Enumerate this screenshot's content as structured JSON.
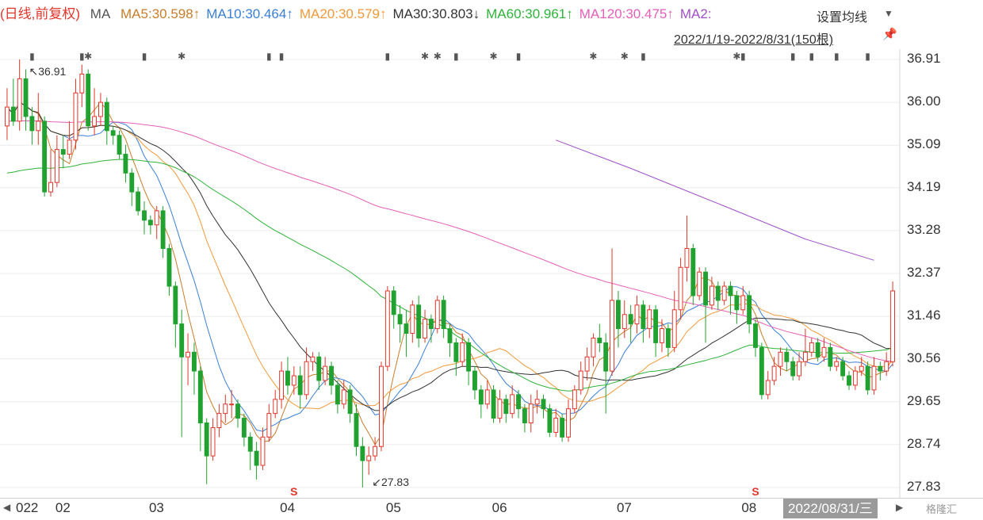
{
  "header": {
    "mode": "(日线,前复权)",
    "ma_label": "MA",
    "ma_items": [
      {
        "text": "MA5:30.598↑",
        "color": "#c87d2c"
      },
      {
        "text": "MA10:30.464↑",
        "color": "#3a7fd6"
      },
      {
        "text": "MA20:30.579↑",
        "color": "#f09a3c"
      },
      {
        "text": "MA30:30.803↓",
        "color": "#333333"
      },
      {
        "text": "MA60:30.961↑",
        "color": "#2fb33a"
      },
      {
        "text": "MA120:30.475↑",
        "color": "#e45fb8"
      },
      {
        "text": "MA2:",
        "color": "#a050c8"
      }
    ],
    "settings_label": "设置均线",
    "settings_arrow": "▼",
    "range": "2022/1/19-2022/8/31(150根)",
    "pin_icon": "pin"
  },
  "chart_data": {
    "type": "candlestick",
    "y_ticks": [
      36.91,
      36.0,
      35.09,
      34.19,
      33.28,
      32.37,
      31.46,
      30.56,
      29.65,
      28.74,
      27.83
    ],
    "ylim": [
      27.83,
      36.91
    ],
    "x_month_labels": [
      {
        "label": "022",
        "index": 0
      },
      {
        "label": "02",
        "index": 8
      },
      {
        "label": "03",
        "index": 23
      },
      {
        "label": "04",
        "index": 44
      },
      {
        "label": "05",
        "index": 61
      },
      {
        "label": "06",
        "index": 78
      },
      {
        "label": "07",
        "index": 98
      },
      {
        "label": "08",
        "index": 118
      }
    ],
    "annotations": [
      {
        "text": "↖36.91",
        "index": 3,
        "value": 36.91
      },
      {
        "text": "↙27.83",
        "index": 58,
        "value": 27.83
      }
    ],
    "event_markers": [
      {
        "text": "S",
        "index": 46
      },
      {
        "text": "S",
        "index": 120
      }
    ],
    "info_marks": [
      {
        "index": 4,
        "type": "bar"
      },
      {
        "index": 12,
        "type": "bar"
      },
      {
        "index": 13,
        "type": "star"
      },
      {
        "index": 22,
        "type": "bar"
      },
      {
        "index": 28,
        "type": "star"
      },
      {
        "index": 42,
        "type": "bar"
      },
      {
        "index": 44,
        "type": "bar"
      },
      {
        "index": 61,
        "type": "bar"
      },
      {
        "index": 67,
        "type": "star"
      },
      {
        "index": 69,
        "type": "star"
      },
      {
        "index": 72,
        "type": "bar"
      },
      {
        "index": 78,
        "type": "star"
      },
      {
        "index": 82,
        "type": "bar"
      },
      {
        "index": 94,
        "type": "star"
      },
      {
        "index": 99,
        "type": "star"
      },
      {
        "index": 102,
        "type": "bar"
      },
      {
        "index": 117,
        "type": "star"
      },
      {
        "index": 118,
        "type": "bar"
      },
      {
        "index": 126,
        "type": "bar"
      },
      {
        "index": 129,
        "type": "bar"
      },
      {
        "index": 133,
        "type": "bar"
      },
      {
        "index": 138,
        "type": "bar"
      }
    ],
    "candles": [
      [
        35.5,
        35.9,
        35.2,
        36.3
      ],
      [
        35.9,
        35.6,
        35.5,
        36.5
      ],
      [
        35.6,
        36.5,
        35.4,
        36.91
      ],
      [
        36.5,
        35.7,
        35.4,
        36.7
      ],
      [
        35.7,
        35.4,
        35.1,
        35.9
      ],
      [
        35.4,
        35.6,
        35.1,
        36.2
      ],
      [
        35.6,
        34.1,
        34.0,
        35.7
      ],
      [
        34.1,
        34.3,
        34.0,
        35.0
      ],
      [
        34.3,
        35.0,
        34.2,
        35.3
      ],
      [
        35.0,
        34.9,
        34.6,
        35.3
      ],
      [
        34.9,
        35.2,
        34.8,
        35.6
      ],
      [
        35.2,
        36.2,
        35.0,
        36.5
      ],
      [
        36.2,
        36.6,
        35.9,
        36.8
      ],
      [
        36.6,
        35.5,
        35.4,
        36.7
      ],
      [
        35.5,
        35.7,
        35.3,
        36.3
      ],
      [
        35.7,
        36.0,
        35.5,
        36.2
      ],
      [
        36.0,
        35.4,
        35.1,
        36.1
      ],
      [
        35.4,
        35.3,
        35.1,
        35.5
      ],
      [
        35.3,
        34.9,
        34.8,
        35.4
      ],
      [
        34.9,
        34.5,
        34.3,
        35.1
      ],
      [
        34.5,
        34.1,
        33.8,
        34.6
      ],
      [
        34.1,
        33.7,
        33.6,
        34.2
      ],
      [
        33.7,
        33.5,
        33.2,
        33.9
      ],
      [
        33.5,
        33.4,
        33.2,
        33.6
      ],
      [
        33.4,
        33.7,
        33.1,
        33.8
      ],
      [
        33.7,
        32.9,
        32.7,
        33.8
      ],
      [
        32.9,
        32.1,
        31.9,
        33.0
      ],
      [
        32.1,
        31.3,
        30.8,
        32.2
      ],
      [
        31.3,
        30.6,
        28.9,
        31.6
      ],
      [
        30.6,
        30.7,
        30.0,
        31.1
      ],
      [
        30.7,
        30.3,
        29.8,
        30.9
      ],
      [
        30.3,
        29.2,
        28.6,
        30.4
      ],
      [
        29.2,
        28.5,
        27.9,
        29.3
      ],
      [
        28.5,
        29.1,
        28.4,
        29.3
      ],
      [
        29.1,
        29.4,
        28.9,
        29.6
      ],
      [
        29.4,
        29.6,
        29.2,
        29.8
      ],
      [
        29.6,
        29.6,
        29.3,
        29.9
      ],
      [
        29.6,
        29.3,
        29.1,
        29.7
      ],
      [
        29.3,
        28.9,
        28.7,
        29.4
      ],
      [
        28.9,
        28.6,
        28.2,
        29.0
      ],
      [
        28.6,
        28.3,
        28.0,
        28.8
      ],
      [
        28.3,
        28.9,
        28.2,
        29.1
      ],
      [
        28.9,
        29.4,
        28.8,
        29.6
      ],
      [
        29.4,
        29.7,
        29.3,
        29.9
      ],
      [
        29.7,
        30.3,
        29.5,
        30.5
      ],
      [
        30.3,
        30.0,
        29.8,
        30.6
      ],
      [
        30.0,
        30.2,
        29.8,
        30.4
      ],
      [
        30.2,
        29.8,
        29.5,
        30.4
      ],
      [
        29.8,
        30.5,
        29.7,
        30.8
      ],
      [
        30.5,
        30.6,
        30.3,
        30.7
      ],
      [
        30.6,
        30.1,
        29.9,
        30.7
      ],
      [
        30.1,
        30.4,
        30.0,
        30.6
      ],
      [
        30.4,
        30.0,
        29.8,
        30.5
      ],
      [
        30.0,
        29.6,
        29.4,
        30.1
      ],
      [
        29.6,
        29.9,
        29.5,
        30.1
      ],
      [
        29.9,
        29.4,
        29.2,
        30.0
      ],
      [
        29.4,
        28.7,
        28.5,
        29.6
      ],
      [
        28.7,
        28.4,
        27.83,
        28.9
      ],
      [
        28.4,
        28.5,
        28.1,
        28.7
      ],
      [
        28.5,
        28.7,
        28.4,
        28.9
      ],
      [
        28.7,
        30.4,
        28.6,
        30.5
      ],
      [
        30.4,
        32.0,
        30.3,
        32.1
      ],
      [
        32.0,
        31.5,
        31.2,
        32.1
      ],
      [
        31.5,
        31.3,
        30.9,
        31.7
      ],
      [
        31.3,
        31.1,
        30.6,
        31.6
      ],
      [
        31.1,
        31.7,
        30.9,
        31.8
      ],
      [
        31.7,
        31.0,
        30.8,
        31.9
      ],
      [
        31.0,
        31.4,
        30.9,
        31.6
      ],
      [
        31.4,
        31.2,
        30.9,
        31.5
      ],
      [
        31.2,
        31.8,
        31.1,
        31.9
      ],
      [
        31.8,
        31.2,
        31.0,
        31.9
      ],
      [
        31.2,
        30.9,
        30.6,
        31.3
      ],
      [
        30.9,
        30.5,
        30.2,
        31.0
      ],
      [
        30.5,
        30.9,
        30.4,
        31.1
      ],
      [
        30.9,
        30.3,
        30.0,
        31.0
      ],
      [
        30.3,
        29.9,
        29.7,
        30.4
      ],
      [
        29.9,
        29.6,
        29.3,
        30.0
      ],
      [
        29.6,
        29.9,
        29.5,
        30.1
      ],
      [
        29.9,
        29.3,
        29.2,
        30.0
      ],
      [
        29.3,
        29.7,
        29.2,
        29.9
      ],
      [
        29.7,
        29.4,
        29.2,
        29.8
      ],
      [
        29.4,
        29.8,
        29.3,
        30.0
      ],
      [
        29.8,
        29.5,
        29.3,
        29.9
      ],
      [
        29.5,
        29.2,
        29.0,
        29.6
      ],
      [
        29.2,
        29.6,
        29.0,
        29.8
      ],
      [
        29.6,
        29.7,
        29.4,
        29.9
      ],
      [
        29.7,
        29.5,
        29.3,
        29.8
      ],
      [
        29.5,
        29.0,
        28.9,
        29.6
      ],
      [
        29.0,
        29.3,
        28.9,
        29.5
      ],
      [
        29.3,
        28.9,
        28.8,
        29.4
      ],
      [
        28.9,
        29.5,
        28.8,
        29.7
      ],
      [
        29.5,
        29.9,
        29.4,
        30.0
      ],
      [
        29.9,
        30.3,
        29.8,
        30.5
      ],
      [
        30.3,
        30.6,
        30.1,
        30.8
      ],
      [
        30.6,
        31.0,
        30.4,
        31.1
      ],
      [
        31.0,
        30.9,
        30.7,
        31.3
      ],
      [
        30.9,
        30.3,
        29.4,
        31.1
      ],
      [
        30.3,
        31.8,
        30.2,
        32.9
      ],
      [
        31.8,
        31.2,
        30.8,
        32.0
      ],
      [
        31.2,
        31.5,
        31.0,
        31.8
      ],
      [
        31.5,
        31.3,
        30.9,
        31.7
      ],
      [
        31.3,
        31.7,
        31.1,
        31.9
      ],
      [
        31.7,
        31.2,
        30.9,
        31.8
      ],
      [
        31.2,
        31.6,
        31.0,
        31.7
      ],
      [
        31.6,
        30.9,
        30.6,
        31.7
      ],
      [
        30.9,
        31.2,
        30.7,
        31.4
      ],
      [
        31.2,
        30.8,
        30.6,
        31.3
      ],
      [
        30.8,
        31.6,
        30.7,
        32.0
      ],
      [
        31.6,
        32.5,
        31.4,
        32.7
      ],
      [
        32.5,
        32.9,
        32.2,
        33.6
      ],
      [
        32.9,
        31.9,
        31.7,
        33.0
      ],
      [
        31.9,
        32.4,
        31.8,
        32.5
      ],
      [
        32.4,
        31.7,
        30.9,
        32.5
      ],
      [
        31.7,
        32.1,
        31.6,
        32.3
      ],
      [
        32.1,
        31.8,
        31.6,
        32.2
      ],
      [
        31.8,
        32.1,
        31.7,
        32.2
      ],
      [
        32.1,
        31.9,
        31.5,
        32.2
      ],
      [
        31.9,
        31.6,
        31.3,
        32.0
      ],
      [
        31.6,
        31.9,
        31.5,
        32.1
      ],
      [
        31.9,
        31.3,
        31.1,
        32.0
      ],
      [
        31.3,
        30.8,
        30.6,
        31.4
      ],
      [
        30.8,
        29.8,
        29.7,
        30.9
      ],
      [
        29.8,
        30.1,
        29.7,
        30.3
      ],
      [
        30.1,
        30.4,
        30.0,
        30.6
      ],
      [
        30.4,
        30.7,
        30.2,
        30.8
      ],
      [
        30.7,
        30.5,
        30.3,
        30.8
      ],
      [
        30.5,
        30.2,
        30.1,
        30.6
      ],
      [
        30.2,
        30.5,
        30.1,
        30.7
      ],
      [
        30.5,
        30.7,
        30.4,
        31.2
      ],
      [
        30.7,
        30.9,
        30.6,
        31.0
      ],
      [
        30.9,
        30.6,
        30.5,
        31.0
      ],
      [
        30.6,
        30.8,
        30.5,
        31.0
      ],
      [
        30.8,
        30.4,
        30.3,
        30.9
      ],
      [
        30.4,
        30.5,
        30.3,
        30.6
      ],
      [
        30.5,
        30.2,
        30.1,
        30.6
      ],
      [
        30.2,
        30.0,
        29.9,
        30.3
      ],
      [
        30.0,
        30.3,
        29.9,
        30.4
      ],
      [
        30.3,
        30.4,
        30.2,
        30.6
      ],
      [
        30.4,
        29.9,
        29.8,
        30.5
      ],
      [
        29.9,
        30.4,
        29.8,
        30.6
      ],
      [
        30.4,
        30.3,
        30.1,
        30.5
      ],
      [
        30.3,
        30.5,
        30.2,
        30.7
      ],
      [
        30.5,
        32.0,
        30.4,
        32.2
      ]
    ],
    "ma_lines": [
      {
        "name": "MA5",
        "color": "#c87d2c",
        "start": 0
      },
      {
        "name": "MA10",
        "color": "#3a7fd6",
        "start": 0
      },
      {
        "name": "MA20",
        "color": "#f09a3c",
        "start": 0
      },
      {
        "name": "MA30",
        "color": "#333333",
        "start": 0
      },
      {
        "name": "MA60",
        "color": "#2fb33a",
        "start": 0
      },
      {
        "name": "MA120",
        "color": "#e45fb8",
        "start": 0
      },
      {
        "name": "MA250",
        "color": "#a050c8",
        "start": 88
      }
    ],
    "ma_anchor_values": {
      "MA60_start": 34.5,
      "MA120_start": 35.6,
      "MA250_points": [
        [
          88,
          35.2
        ],
        [
          100,
          34.6
        ],
        [
          115,
          33.8
        ],
        [
          128,
          33.1
        ],
        [
          139,
          32.65
        ]
      ]
    },
    "up_color": "#e0362b",
    "down_color": "#21a230",
    "grid": true
  },
  "xaxis": {
    "cursor_date": "2022/08/31/三",
    "nav_left": "◀",
    "nav_right": "▶",
    "logo": "格隆汇"
  }
}
